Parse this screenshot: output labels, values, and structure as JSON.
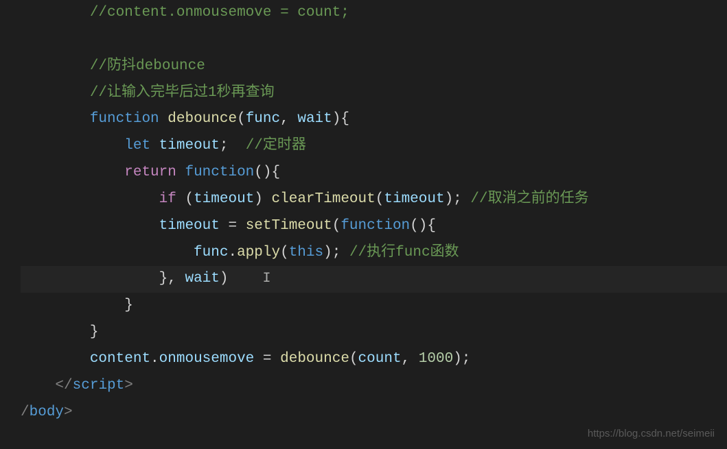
{
  "code": {
    "line1_comment": "//content.onmousemove = count;",
    "line3_comment": "//防抖debounce",
    "line4_comment": "//让输入完毕后过1秒再查询",
    "line5_function": "function",
    "line5_name": "debounce",
    "line5_param1": "func",
    "line5_param2": "wait",
    "line6_let": "let",
    "line6_var": "timeout",
    "line6_comment": "//定时器",
    "line7_return": "return",
    "line7_function": "function",
    "line8_if": "if",
    "line8_var": "timeout",
    "line8_fn": "clearTimeout",
    "line8_arg": "timeout",
    "line8_comment": "//取消之前的任务",
    "line9_var": "timeout",
    "line9_fn": "setTimeout",
    "line9_function": "function",
    "line10_var": "func",
    "line10_fn": "apply",
    "line10_this": "this",
    "line10_comment": "//执行func函数",
    "line11_var": "wait",
    "line14_var1": "content",
    "line14_var2": "onmousemove",
    "line14_fn": "debounce",
    "line14_arg1": "count",
    "line14_arg2": "1000",
    "line15_tag": "script",
    "line16_tag": "body"
  },
  "watermark": "https://blog.csdn.net/seimeii"
}
